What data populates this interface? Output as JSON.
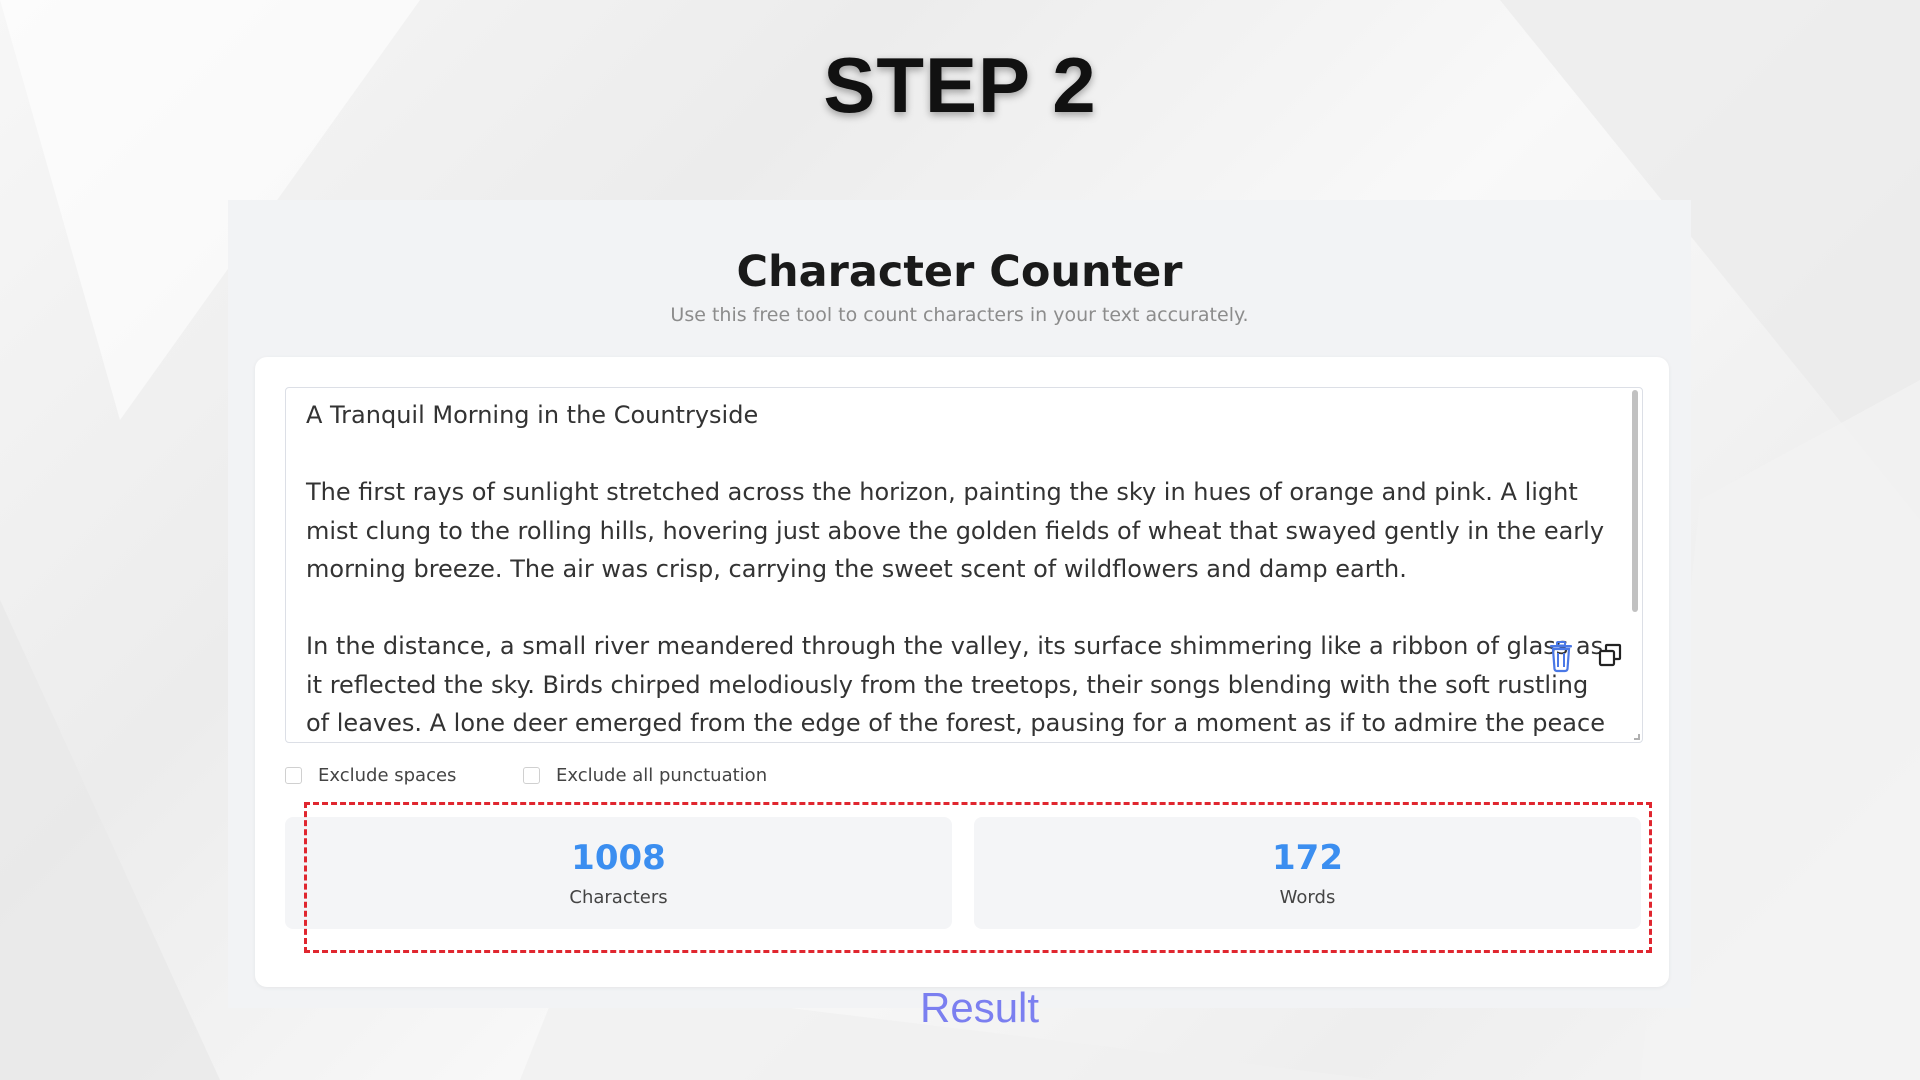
{
  "step_title": "STEP 2",
  "app": {
    "title": "Character Counter",
    "subtitle": "Use this free tool to count characters in your text accurately."
  },
  "text_input": {
    "paragraphs": [
      "A Tranquil Morning in the Countryside",
      "The first rays of sunlight stretched across the horizon, painting the sky in hues of orange and pink. A light mist clung to the rolling hills, hovering just above the golden fields of wheat that swayed gently in the early morning breeze. The air was crisp, carrying the sweet scent of wildflowers and damp earth.",
      "In the distance, a small river meandered through the valley, its surface shimmering like a ribbon of glass as it reflected the sky. Birds chirped melodiously from the treetops, their songs blending with the soft rustling of leaves. A lone deer emerged from the edge of the forest, pausing for a moment as if to admire the peace"
    ]
  },
  "icons": {
    "delete": "trash-icon",
    "copy": "copy-icon"
  },
  "options": {
    "exclude_spaces": "Exclude spaces",
    "exclude_punctuation": "Exclude all punctuation"
  },
  "stats": {
    "characters": {
      "value": "1008",
      "label": "Characters"
    },
    "words": {
      "value": "172",
      "label": "Words"
    }
  },
  "annotation": {
    "result_label": "Result"
  },
  "colors": {
    "accent": "#3b8ef0",
    "highlight": "#e0262f",
    "annotation": "#7b7ff0"
  }
}
